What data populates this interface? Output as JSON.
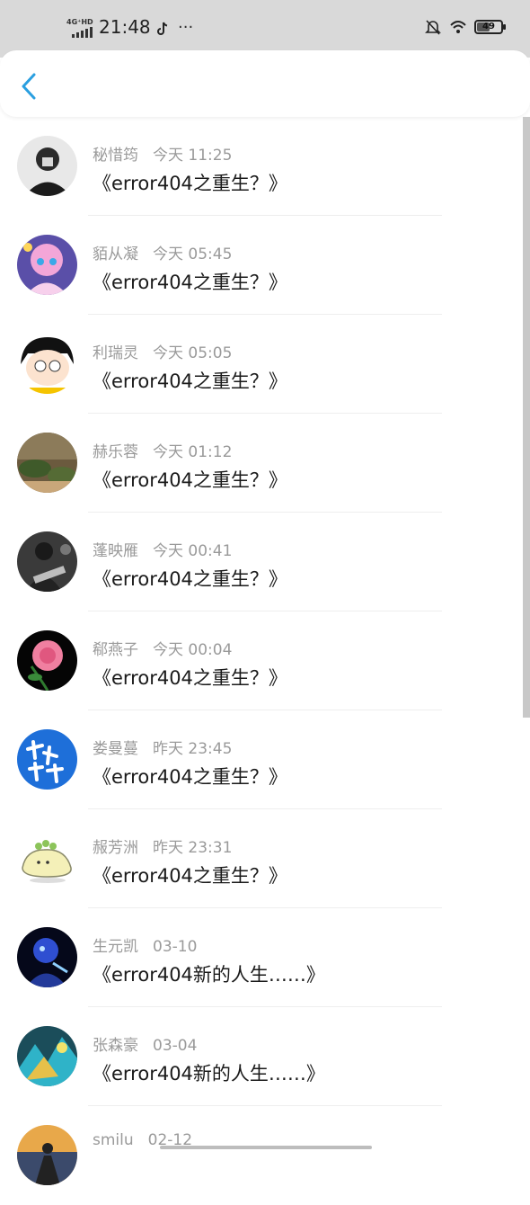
{
  "status_bar": {
    "network": "4G⁺HD",
    "time": "21:48",
    "more": "···",
    "battery": "49"
  },
  "conversations": [
    {
      "name": "秘惜筠",
      "time": "今天  11:25",
      "message": "《error404之重生？》",
      "avatar": "grayscale-portrait"
    },
    {
      "name": "貊从凝",
      "time": "今天  05:45",
      "message": "《error404之重生？》",
      "avatar": "anime-girl-pink"
    },
    {
      "name": "利瑞灵",
      "time": "今天  05:05",
      "message": "《error404之重生？》",
      "avatar": "cartoon-girl-yellow"
    },
    {
      "name": "赫乐蓉",
      "time": "今天  01:12",
      "message": "《error404之重生？》",
      "avatar": "nature-scene"
    },
    {
      "name": "蓬映雁",
      "time": "今天  00:41",
      "message": "《error404之重生？》",
      "avatar": "guitarist-bw"
    },
    {
      "name": "郗燕子",
      "time": "今天  00:04",
      "message": "《error404之重生？》",
      "avatar": "pink-rose"
    },
    {
      "name": "娄曼蔓",
      "time": "昨天  23:45",
      "message": "《error404之重生？》",
      "avatar": "blue-calligraphy"
    },
    {
      "name": "赧芳洲",
      "time": "昨天  23:31",
      "message": "《error404之重生？》",
      "avatar": "cute-creature"
    },
    {
      "name": "生元凯",
      "time": "03-10",
      "message": "《error404新的人生……》",
      "avatar": "blue-glow"
    },
    {
      "name": "张森豪",
      "time": "03-04",
      "message": "《error404新的人生……》",
      "avatar": "colorful-art"
    },
    {
      "name": "smilu",
      "time": "02-12",
      "message": "",
      "avatar": "sunset-silhouette"
    }
  ],
  "colors": {
    "accent": "#2a9fe0",
    "meta_text": "#9a9a9a",
    "message_text": "#1a1a1a"
  }
}
